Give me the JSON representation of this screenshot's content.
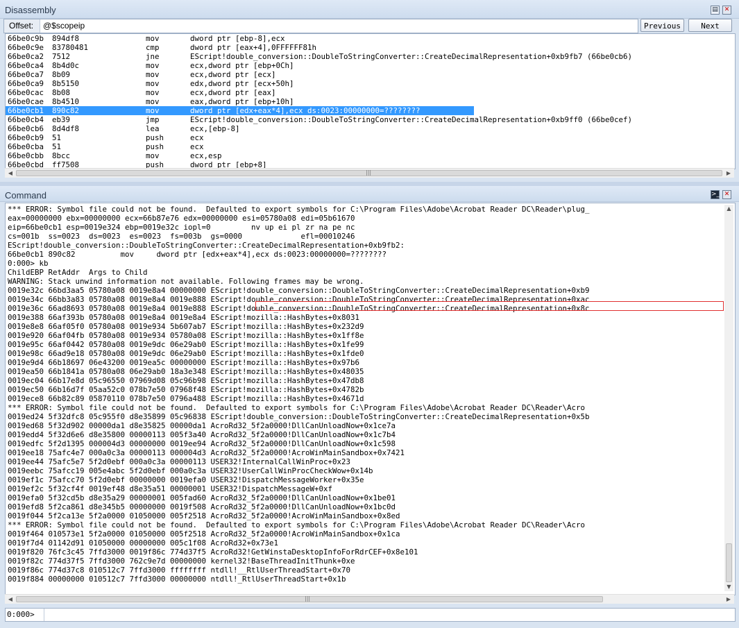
{
  "disassembly": {
    "title": "Disassembly",
    "offset_label": "Offset:",
    "offset_value": "@$scopeip",
    "previous_label": "Previous",
    "next_label": "Next",
    "lines": [
      {
        "addr": "66be0c9b",
        "bytes": "894df8",
        "mnem": "mov",
        "ops": "dword ptr [ebp-8],ecx"
      },
      {
        "addr": "66be0c9e",
        "bytes": "83780481",
        "mnem": "cmp",
        "ops": "dword ptr [eax+4],0FFFFFF81h"
      },
      {
        "addr": "66be0ca2",
        "bytes": "7512",
        "mnem": "jne",
        "ops": "EScript!double_conversion::DoubleToStringConverter::CreateDecimalRepresentation+0xb9fb7 (66be0cb6)"
      },
      {
        "addr": "66be0ca4",
        "bytes": "8b4d0c",
        "mnem": "mov",
        "ops": "ecx,dword ptr [ebp+0Ch]"
      },
      {
        "addr": "66be0ca7",
        "bytes": "8b09",
        "mnem": "mov",
        "ops": "ecx,dword ptr [ecx]"
      },
      {
        "addr": "66be0ca9",
        "bytes": "8b5150",
        "mnem": "mov",
        "ops": "edx,dword ptr [ecx+50h]"
      },
      {
        "addr": "66be0cac",
        "bytes": "8b08",
        "mnem": "mov",
        "ops": "ecx,dword ptr [eax]"
      },
      {
        "addr": "66be0cae",
        "bytes": "8b4510",
        "mnem": "mov",
        "ops": "eax,dword ptr [ebp+10h]"
      },
      {
        "addr": "66be0cb1",
        "bytes": "890c82",
        "mnem": "mov",
        "ops": "dword ptr [edx+eax*4],ecx ds:0023:00000000=????????",
        "highlight": true
      },
      {
        "addr": "66be0cb4",
        "bytes": "eb39",
        "mnem": "jmp",
        "ops": "EScript!double_conversion::DoubleToStringConverter::CreateDecimalRepresentation+0xb9ff0 (66be0cef)"
      },
      {
        "addr": "66be0cb6",
        "bytes": "8d4df8",
        "mnem": "lea",
        "ops": "ecx,[ebp-8]"
      },
      {
        "addr": "66be0cb9",
        "bytes": "51",
        "mnem": "push",
        "ops": "ecx"
      },
      {
        "addr": "66be0cba",
        "bytes": "51",
        "mnem": "push",
        "ops": "ecx"
      },
      {
        "addr": "66be0cbb",
        "bytes": "8bcc",
        "mnem": "mov",
        "ops": "ecx,esp"
      },
      {
        "addr": "66be0cbd",
        "bytes": "ff7508",
        "mnem": "push",
        "ops": "dword ptr [ebp+8]"
      }
    ]
  },
  "command": {
    "title": "Command",
    "prompt_label": "0:000>",
    "input_value": "",
    "lines": [
      "*** ERROR: Symbol file could not be found.  Defaulted to export symbols for C:\\Program Files\\Adobe\\Acrobat Reader DC\\Reader\\plug_",
      "eax=00000000 ebx=00000000 ecx=66b87e76 edx=00000000 esi=05780a08 edi=05b61670",
      "eip=66be0cb1 esp=0019e324 ebp=0019e32c iopl=0         nv up ei pl zr na pe nc",
      "cs=001b  ss=0023  ds=0023  es=0023  fs=003b  gs=0000             efl=00010246",
      "EScript!double_conversion::DoubleToStringConverter::CreateDecimalRepresentation+0xb9fb2:",
      "66be0cb1 890c82          mov     dword ptr [edx+eax*4],ecx ds:0023:00000000=????????",
      "0:000> kb",
      "ChildEBP RetAddr  Args to Child",
      "WARNING: Stack unwind information not available. Following frames may be wrong.",
      "0019e32c 66bd3aa5 05780a08 0019e8a4 00000000 EScript!double_conversion::DoubleToStringConverter::CreateDecimalRepresentation+0xb9",
      "0019e34c 66bb3a83 05780a08 0019e8a4 0019e888 EScript!double_conversion::DoubleToStringConverter::CreateDecimalRepresentation+0xac",
      "0019e36c 66ad8693 05780a08 0019e8a4 0019e888 EScript!double_conversion::DoubleToStringConverter::CreateDecimalRepresentation+0x8c",
      "0019e388 66af393b 05780a08 0019e8a4 0019e8a4 EScript!mozilla::HashBytes+0x8031",
      "0019e8e8 66af05f0 05780a08 0019e934 5b607ab7 EScript!mozilla::HashBytes+0x232d9",
      "0019e920 66af04fb 05780a08 0019e934 05780a08 EScript!mozilla::HashBytes+0x1ff8e",
      "0019e95c 66af0442 05780a08 0019e9dc 06e29ab0 EScript!mozilla::HashBytes+0x1fe99",
      "0019e98c 66ad9e18 05780a08 0019e9dc 06e29ab0 EScript!mozilla::HashBytes+0x1fde0",
      "0019e9d4 66b18697 06e43200 0019ea5c 00000000 EScript!mozilla::HashBytes+0x97b6",
      "0019ea50 66b1841a 05780a08 06e29ab0 18a3e348 EScript!mozilla::HashBytes+0x48035",
      "0019ec04 66b17e8d 05c96550 07969d08 05c96b98 EScript!mozilla::HashBytes+0x47db8",
      "0019ec50 66b16d7f 05aa52c0 078b7e50 07968f48 EScript!mozilla::HashBytes+0x4782b",
      "0019ece8 66b82c89 05870110 078b7e50 0796a488 EScript!mozilla::HashBytes+0x4671d",
      "*** ERROR: Symbol file could not be found.  Defaulted to export symbols for C:\\Program Files\\Adobe\\Acrobat Reader DC\\Reader\\Acro",
      "0019ed24 5f32dfc8 05c955f0 d8e35899 05c96838 EScript!double_conversion::DoubleToStringConverter::CreateDecimalRepresentation+0x5b",
      "0019ed68 5f32d902 00000da1 d8e35825 00000da1 AcroRd32_5f2a0000!DllCanUnloadNow+0x1ce7a",
      "0019edd4 5f32d6e6 d8e35800 00000113 005f3a40 AcroRd32_5f2a0000!DllCanUnloadNow+0x1c7b4",
      "0019edfc 5f2d1395 000004d3 00000000 0019ee94 AcroRd32_5f2a0000!DllCanUnloadNow+0x1c598",
      "0019ee18 75afc4e7 000a0c3a 00000113 000004d3 AcroRd32_5f2a0000!AcroWinMainSandbox+0x7421",
      "0019ee44 75afc5e7 5f2d0ebf 000a0c3a 00000113 USER32!InternalCallWinProc+0x23",
      "0019eebc 75afcc19 005e4abc 5f2d0ebf 000a0c3a USER32!UserCallWinProcCheckWow+0x14b",
      "0019ef1c 75afcc70 5f2d0ebf 00000000 0019efa0 USER32!DispatchMessageWorker+0x35e",
      "0019ef2c 5f32cf4f 0019ef48 d8e35a51 00000001 USER32!DispatchMessageW+0xf",
      "0019efa0 5f32cd5b d8e35a29 00000001 005fad60 AcroRd32_5f2a0000!DllCanUnloadNow+0x1be01",
      "0019efd8 5f2ca861 d8e345b5 00000000 0019f508 AcroRd32_5f2a0000!DllCanUnloadNow+0x1bc0d",
      "0019f044 5f2ca13e 5f2a0000 01050000 005f2518 AcroRd32_5f2a0000!AcroWinMainSandbox+0x8ed",
      "*** ERROR: Symbol file could not be found.  Defaulted to export symbols for C:\\Program Files\\Adobe\\Acrobat Reader DC\\Reader\\Acro",
      "0019f464 010573e1 5f2a0000 01050000 005f2518 AcroRd32_5f2a0000!AcroWinMainSandbox+0x1ca",
      "0019f7d4 01142d91 01050000 00000000 005c1f08 AcroRd32+0x73e1",
      "0019f820 76fc3c45 7ffd3000 0019f86c 774d37f5 AcroRd32!GetWinstaDesktopInfoForRdrCEF+0x8e101",
      "0019f82c 774d37f5 7ffd3000 762c9e7d 00000000 kernel32!BaseThreadInitThunk+0xe",
      "0019f86c 774d37c8 010512c7 7ffd3000 ffffffff ntdll!__RtlUserThreadStart+0x70",
      "0019f884 00000000 010512c7 7ffd3000 00000000 ntdll!_RtlUserThreadStart+0x1b"
    ]
  }
}
